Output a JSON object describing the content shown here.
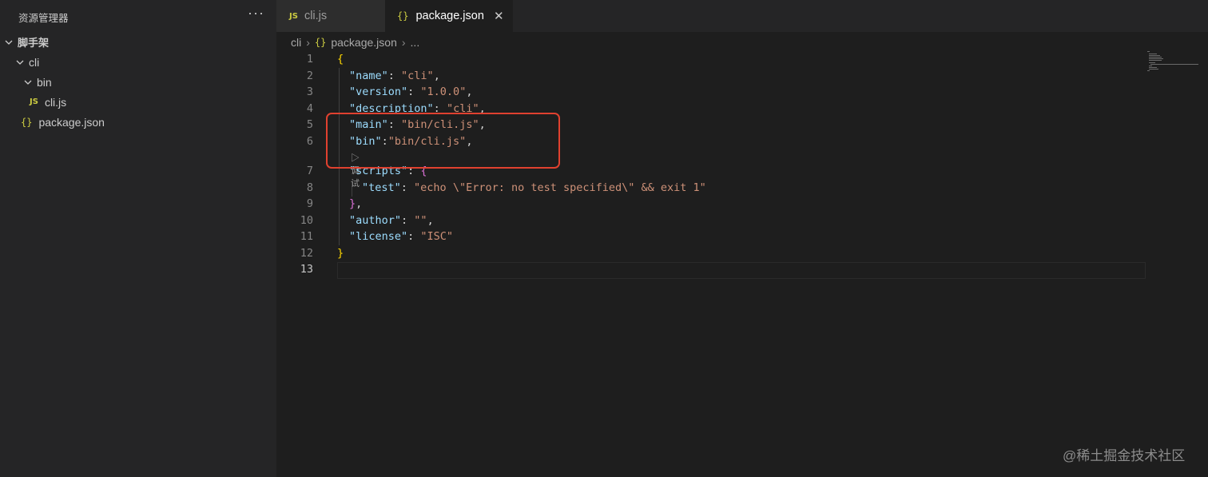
{
  "explorer": {
    "title": "资源管理器",
    "more_label": "···",
    "tree": {
      "root": "脚手架",
      "folder_cli": "cli",
      "folder_bin": "bin",
      "file_clijs": "cli.js",
      "file_package": "package.json",
      "js_icon": "JS",
      "json_icon": "{}"
    }
  },
  "tabs": [
    {
      "label": "cli.js",
      "icon": "JS",
      "active": false
    },
    {
      "label": "package.json",
      "icon": "{}",
      "active": true
    }
  ],
  "tab_close_icon": "✕",
  "breadcrumb": {
    "segment1": "cli",
    "segment2": "package.json",
    "segment3": "...",
    "json_icon": "{}"
  },
  "editor": {
    "line_numbers": [
      "1",
      "2",
      "3",
      "4",
      "5",
      "6",
      "7",
      "8",
      "9",
      "10",
      "11",
      "12",
      "13"
    ],
    "current_line": "13",
    "codelens": "▷ 调试",
    "code": {
      "l1_open": "{",
      "name_key": "\"name\"",
      "name_val": "\"cli\"",
      "version_key": "\"version\"",
      "version_val": "\"1.0.0\"",
      "description_key": "\"description\"",
      "description_val": "\"cli\"",
      "main_key": "\"main\"",
      "main_val": "\"bin/cli.js\"",
      "bin_key": "\"bin\"",
      "bin_val": "\"bin/cli.js\"",
      "scripts_key": "\"scripts\"",
      "scripts_open": "{",
      "test_key": "\"test\"",
      "test_val": "\"echo \\\"Error: no test specified\\\" && exit 1\"",
      "scripts_close": "}",
      "author_key": "\"author\"",
      "author_val": "\"\"",
      "license_key": "\"license\"",
      "license_val": "\"ISC\"",
      "l12_close": "}"
    }
  },
  "colors": {
    "accent_highlight": "#e0412f",
    "json_key": "#9cdcfe",
    "json_string": "#ce9178",
    "bracket_gold": "#ffd700",
    "bracket_purple": "#da70d6"
  },
  "watermark": "@稀土掘金技术社区"
}
